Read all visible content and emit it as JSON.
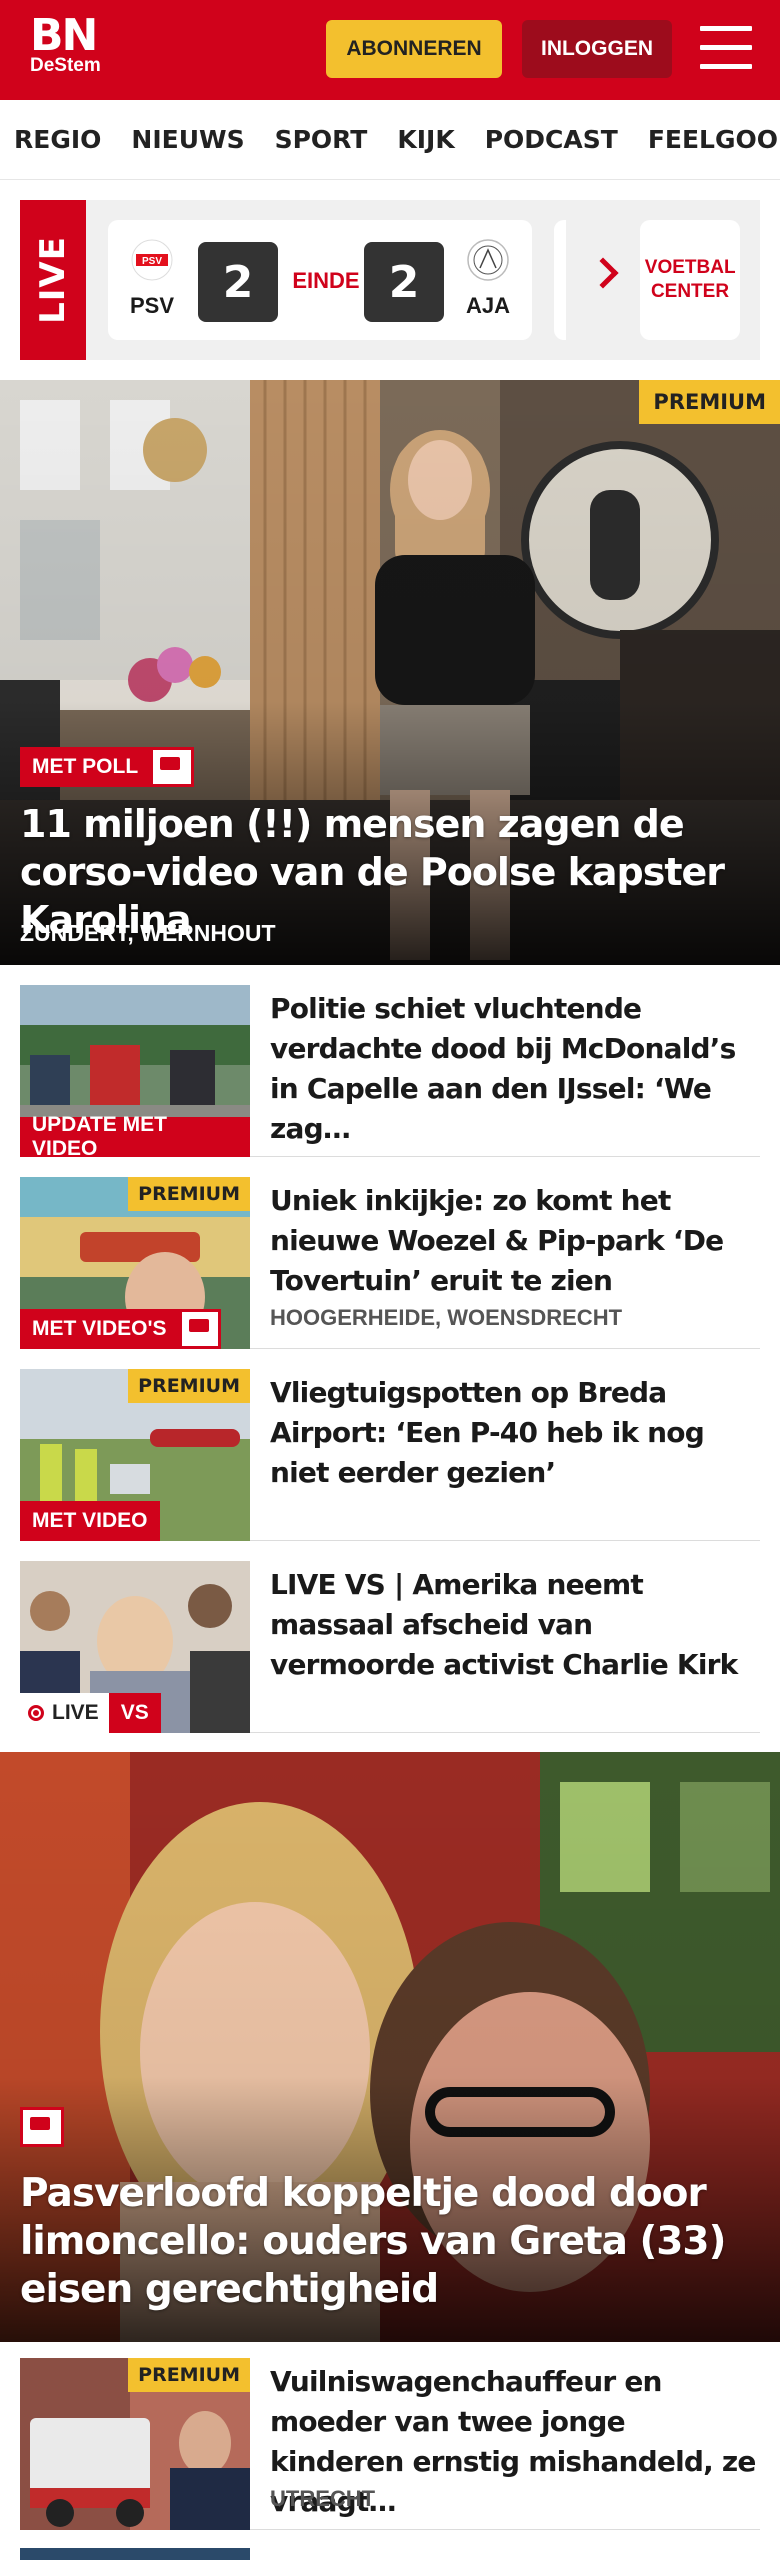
{
  "header": {
    "logo_main": "BN",
    "logo_sub": "DeStem",
    "subscribe_label": "ABONNEREN",
    "login_label": "INLOGGEN"
  },
  "nav": {
    "items": [
      "REGIO",
      "NIEUWS",
      "SPORT",
      "KIJK",
      "PODCAST",
      "FEELGOOD"
    ]
  },
  "live": {
    "label": "LIVE",
    "match": {
      "home": "PSV",
      "away": "AJA",
      "home_score": "2",
      "away_score": "2",
      "status": "EINDE"
    },
    "voetbal_center": "VOETBAL CENTER"
  },
  "hero": {
    "premium": "PREMIUM",
    "badge": "MET POLL",
    "title": "11 miljoen (!!) mensen zagen de corso-video van de Poolse kapster Karolina",
    "location": "ZUNDERT, WERNHOUT"
  },
  "articles": [
    {
      "title": "Politie schiet vluchtende verdachte dood bij McDonald’s in Capelle aan den IJssel: ‘We zag…",
      "badge": "UPDATE MET VIDEO",
      "premium": "",
      "location": ""
    },
    {
      "title": "Uniek inkijkje: zo komt het nieuwe Woezel & Pip-park ‘De Tovertuin’ eruit te zien",
      "badge": "MET VIDEO'S",
      "premium": "PREMIUM",
      "location": "HOOGERHEIDE, WOENSDRECHT"
    },
    {
      "title": "Vliegtuigspotten op Breda Airport: ‘Een P-40 heb ik nog niet eerder gezien’",
      "badge": "MET VIDEO",
      "premium": "PREMIUM",
      "location": ""
    },
    {
      "title": "LIVE VS | Amerika neemt massaal afscheid van vermoorde activist Charlie Kirk",
      "badge_live": "LIVE",
      "badge_vs": "VS",
      "premium": "",
      "location": ""
    }
  ],
  "hero2": {
    "title": "Pasverloofd koppeltje dood door limoncello: ouders van Greta (33) eisen gerechtigheid"
  },
  "article_bottom": {
    "title": "Vuilniswagenchauffeur en moeder van twee jonge kinderen ernstig mishandeld, ze vraagt…",
    "premium": "PREMIUM",
    "location": "UTRECHT"
  },
  "colors": {
    "brand_red": "#d0021b",
    "premium_yellow": "#f3c02e",
    "login_dark_red": "#9d0c1c"
  }
}
